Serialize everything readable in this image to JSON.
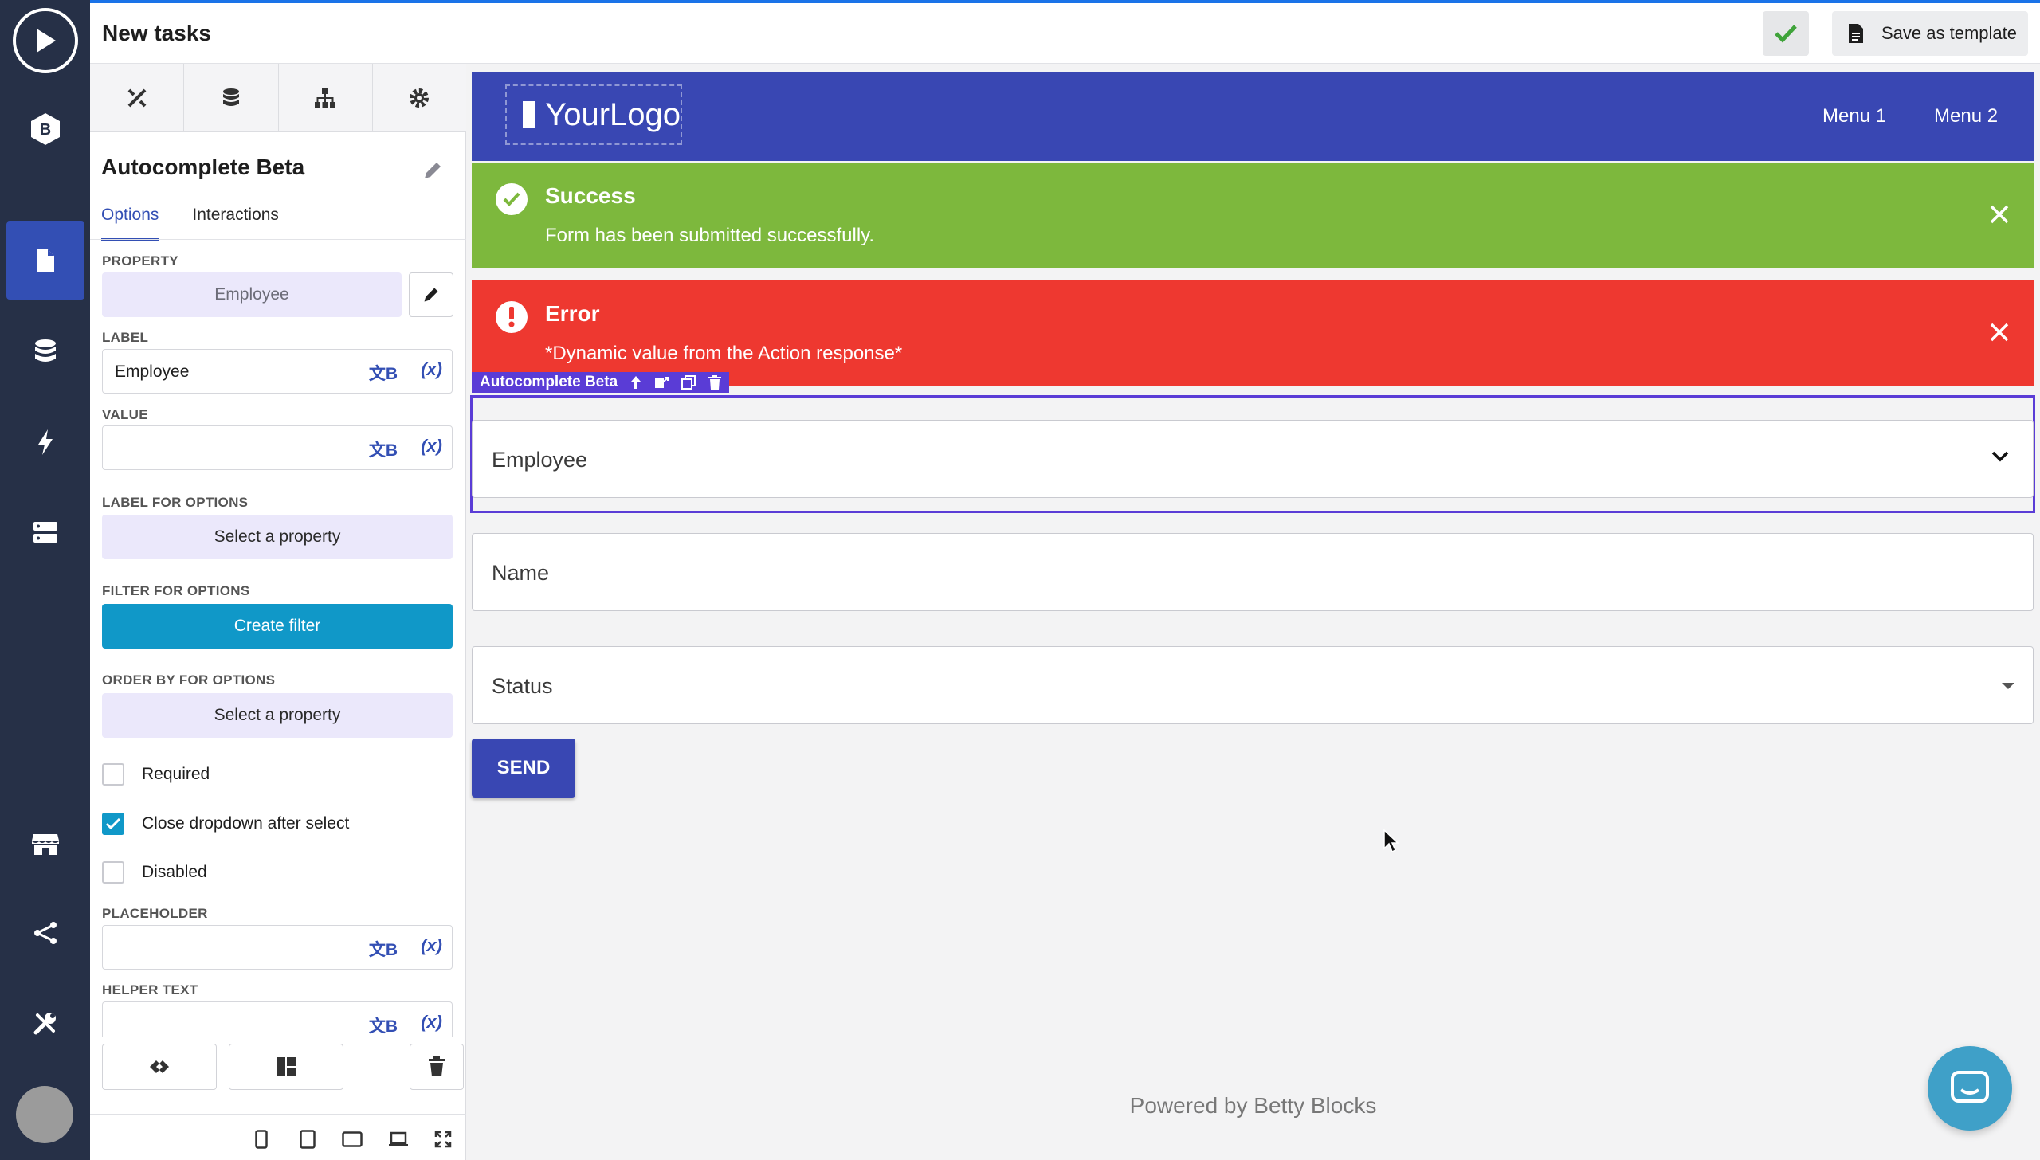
{
  "header": {
    "title": "New tasks",
    "save_template_label": "Save as template"
  },
  "panel": {
    "component_name": "Autocomplete Beta",
    "tabs": [
      "Options",
      "Interactions"
    ],
    "property": {
      "label": "PROPERTY",
      "value": "Employee"
    },
    "label_field": {
      "label": "LABEL",
      "value": "Employee"
    },
    "value_field": {
      "label": "VALUE",
      "value": ""
    },
    "label_for_options": {
      "label": "LABEL FOR OPTIONS",
      "value": "Select a property"
    },
    "filter_for_options": {
      "label": "FILTER FOR OPTIONS",
      "button": "Create filter"
    },
    "order_by": {
      "label": "ORDER BY FOR OPTIONS",
      "value": "Select a property"
    },
    "checkboxes": [
      {
        "label": "Required",
        "checked": false
      },
      {
        "label": "Close dropdown after select",
        "checked": true
      },
      {
        "label": "Disabled",
        "checked": false
      }
    ],
    "placeholder_field": {
      "label": "PLACEHOLDER",
      "value": ""
    },
    "helper_text_field": {
      "label": "HELPER TEXT",
      "value": ""
    },
    "translate_symbol": "文B",
    "variable_symbol": "(x)"
  },
  "canvas": {
    "logo": {
      "part1": "Your",
      "part2": "Logo"
    },
    "menu": [
      "Menu 1",
      "Menu 2"
    ],
    "success": {
      "title": "Success",
      "message": "Form has been submitted successfully."
    },
    "error": {
      "title": "Error",
      "message": "*Dynamic value from the Action response*"
    },
    "selected_tag": "Autocomplete Beta",
    "fields": [
      "Employee",
      "Name",
      "Status"
    ],
    "send_label": "SEND",
    "powered_by": "Powered by Betty Blocks"
  },
  "colors": {
    "rail": "#263047",
    "accent": "#334fb4",
    "navbar": "#3947b3",
    "success": "#7db83d",
    "error": "#ee3830",
    "filter_button": "#1098c8",
    "selection": "#5a3cd6"
  }
}
